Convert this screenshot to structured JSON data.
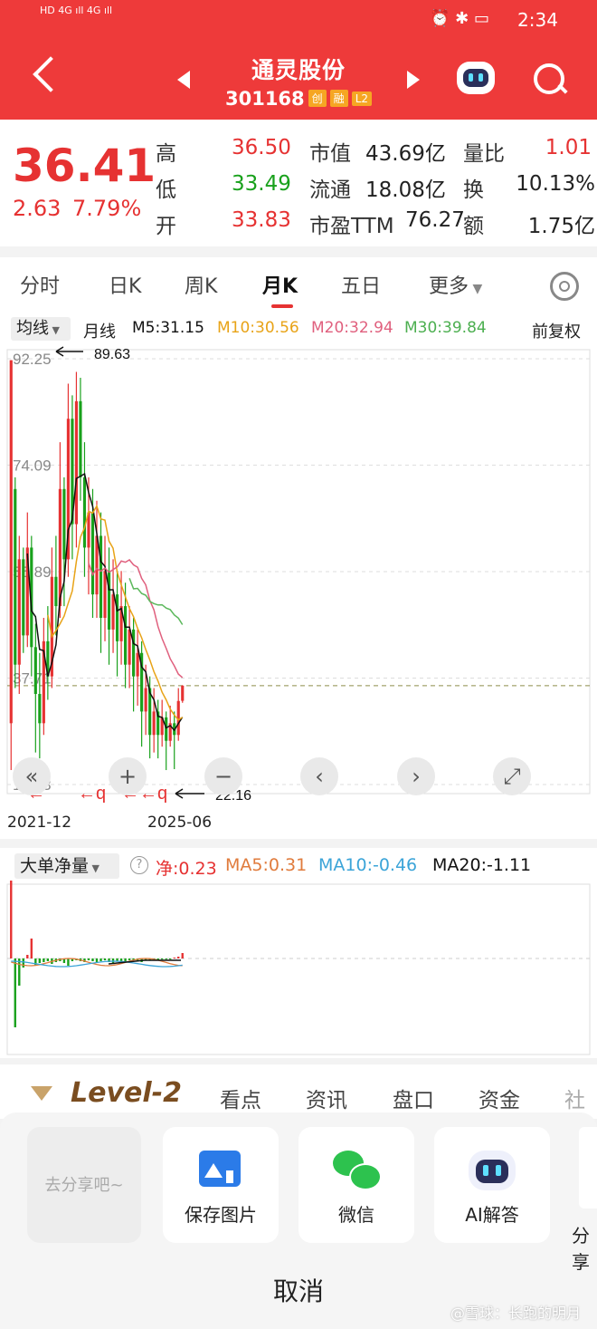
{
  "status_bar": {
    "time": "2:34",
    "network": "HD 4G 4G"
  },
  "header": {
    "stock_name": "通灵股份",
    "stock_code": "301168",
    "tags": [
      "创",
      "融",
      "L2"
    ]
  },
  "quote": {
    "price": "36.41",
    "change": "2.63",
    "change_pct": "7.79%",
    "rows": [
      {
        "l1": "高",
        "v1": "36.50",
        "l2": "市值",
        "v2": "43.69亿",
        "l3": "量比",
        "v3": "1.01"
      },
      {
        "l1": "低",
        "v1": "33.49",
        "l2": "流通",
        "v2": "18.08亿",
        "l3": "换",
        "v3": "10.13%"
      },
      {
        "l1": "开",
        "v1": "33.83",
        "l2": "市盈TTM",
        "v2": "76.27",
        "l3": "额",
        "v3": "1.75亿"
      }
    ]
  },
  "tabs": {
    "items": [
      "分时",
      "日K",
      "周K",
      "月K",
      "五日",
      "更多"
    ],
    "active": "月K"
  },
  "ma_bar": {
    "mode": "均线",
    "period": "月线",
    "m5": "M5:31.15",
    "m10": "M10:30.56",
    "m20": "M20:32.94",
    "m30": "M30:39.84",
    "adjust": "前复权"
  },
  "colors": {
    "up": "#e63232",
    "down": "#19a11c",
    "m5": "#111111",
    "m10": "#e8a317",
    "m20": "#e0607e",
    "m30": "#5cb85c",
    "header": "#ee3a3a"
  },
  "chart_data": {
    "type": "candlestick",
    "y_ticks": [
      "92.25",
      "74.09",
      "55.89",
      "37.71",
      "19.53"
    ],
    "ylim": [
      19.53,
      92.25
    ],
    "x_labels": [
      "2021-12",
      "2025-06"
    ],
    "reference_price": 36.41,
    "annotations": {
      "high_marker": "89.63",
      "low_marker": "22.16"
    },
    "candles": [
      {
        "o": 30,
        "c": 92,
        "h": 92,
        "l": 22
      },
      {
        "o": 70,
        "c": 40,
        "h": 72,
        "l": 36
      },
      {
        "o": 40,
        "c": 58,
        "h": 62,
        "l": 35
      },
      {
        "o": 58,
        "c": 45,
        "h": 60,
        "l": 42
      },
      {
        "o": 45,
        "c": 60,
        "h": 66,
        "l": 43
      },
      {
        "o": 60,
        "c": 43,
        "h": 62,
        "l": 38
      },
      {
        "o": 43,
        "c": 35,
        "h": 47,
        "l": 25
      },
      {
        "o": 35,
        "c": 30,
        "h": 42,
        "l": 24
      },
      {
        "o": 30,
        "c": 44,
        "h": 48,
        "l": 28
      },
      {
        "o": 44,
        "c": 38,
        "h": 50,
        "l": 34
      },
      {
        "o": 38,
        "c": 55,
        "h": 60,
        "l": 36
      },
      {
        "o": 55,
        "c": 50,
        "h": 62,
        "l": 45
      },
      {
        "o": 50,
        "c": 70,
        "h": 78,
        "l": 48
      },
      {
        "o": 70,
        "c": 58,
        "h": 72,
        "l": 50
      },
      {
        "o": 58,
        "c": 82,
        "h": 88,
        "l": 55
      },
      {
        "o": 82,
        "c": 64,
        "h": 86,
        "l": 58
      },
      {
        "o": 64,
        "c": 85,
        "h": 90,
        "l": 60
      },
      {
        "o": 85,
        "c": 72,
        "h": 89,
        "l": 68
      },
      {
        "o": 72,
        "c": 60,
        "h": 78,
        "l": 55
      },
      {
        "o": 60,
        "c": 66,
        "h": 72,
        "l": 52
      },
      {
        "o": 66,
        "c": 52,
        "h": 70,
        "l": 48
      },
      {
        "o": 52,
        "c": 62,
        "h": 68,
        "l": 48
      },
      {
        "o": 62,
        "c": 48,
        "h": 66,
        "l": 42
      },
      {
        "o": 48,
        "c": 56,
        "h": 62,
        "l": 44
      },
      {
        "o": 56,
        "c": 46,
        "h": 60,
        "l": 40
      },
      {
        "o": 46,
        "c": 52,
        "h": 58,
        "l": 42
      },
      {
        "o": 52,
        "c": 44,
        "h": 56,
        "l": 38
      },
      {
        "o": 44,
        "c": 50,
        "h": 56,
        "l": 40
      },
      {
        "o": 50,
        "c": 40,
        "h": 54,
        "l": 36
      },
      {
        "o": 40,
        "c": 46,
        "h": 50,
        "l": 36
      },
      {
        "o": 46,
        "c": 38,
        "h": 48,
        "l": 32
      },
      {
        "o": 38,
        "c": 42,
        "h": 46,
        "l": 33
      },
      {
        "o": 42,
        "c": 32,
        "h": 44,
        "l": 26
      },
      {
        "o": 32,
        "c": 36,
        "h": 40,
        "l": 28
      },
      {
        "o": 36,
        "c": 28,
        "h": 38,
        "l": 24
      },
      {
        "o": 28,
        "c": 32,
        "h": 36,
        "l": 25
      },
      {
        "o": 32,
        "c": 28,
        "h": 34,
        "l": 24
      },
      {
        "o": 28,
        "c": 31,
        "h": 34,
        "l": 26
      },
      {
        "o": 31,
        "c": 27,
        "h": 32,
        "l": 22
      },
      {
        "o": 27,
        "c": 30,
        "h": 33,
        "l": 26
      },
      {
        "o": 30,
        "c": 28,
        "h": 32,
        "l": 22.16
      },
      {
        "o": 28,
        "c": 33.8,
        "h": 36,
        "l": 27
      },
      {
        "o": 33.83,
        "c": 36.41,
        "h": 36.5,
        "l": 33.49
      }
    ]
  },
  "indicator": {
    "name": "大单净量",
    "net": "净:0.23",
    "ma5": "MA5:0.31",
    "ma10": "MA10:-0.46",
    "ma20": "MA20:-1.11"
  },
  "level2_bar": {
    "brand": "Level-2",
    "items": [
      "看点",
      "资讯",
      "盘口",
      "资金",
      "社"
    ]
  },
  "share_sheet": {
    "preview_label": "去分享吧~",
    "options": [
      {
        "label": "保存图片"
      },
      {
        "label": "微信"
      },
      {
        "label": "AI解答"
      }
    ],
    "edge_label": "分享",
    "cancel": "取消",
    "watermark": "@雪球：长跑的明月"
  }
}
